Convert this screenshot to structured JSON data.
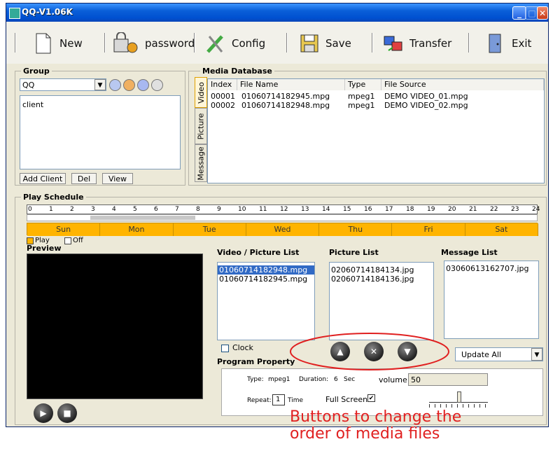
{
  "window": {
    "title": "QQ-V1.06K"
  },
  "toolbar": {
    "new": "New",
    "password": "password",
    "config": "Config",
    "save": "Save",
    "transfer": "Transfer",
    "exit": "Exit"
  },
  "group": {
    "legend": "Group",
    "selected": "QQ",
    "clients": [
      "client"
    ],
    "add_client": "Add Client",
    "del": "Del",
    "view": "View"
  },
  "media": {
    "legend": "Media Database",
    "tabs": [
      "Video",
      "Picture",
      "Message"
    ],
    "columns": [
      "Index",
      "File Name",
      "Type",
      "File Source"
    ],
    "rows": [
      [
        "00001",
        "01060714182945.mpg",
        "mpeg1",
        "DEMO VIDEO_01.mpg"
      ],
      [
        "00002",
        "01060714182948.mpg",
        "mpeg1",
        "DEMO VIDEO_02.mpg"
      ]
    ]
  },
  "schedule": {
    "legend": "Play Schedule",
    "hours": [
      "0",
      "1",
      "2",
      "3",
      "4",
      "5",
      "6",
      "7",
      "8",
      "9",
      "10",
      "11",
      "12",
      "13",
      "14",
      "15",
      "16",
      "17",
      "18",
      "19",
      "20",
      "21",
      "22",
      "23",
      "24"
    ],
    "days": [
      "Sun",
      "Mon",
      "Tue",
      "Wed",
      "Thu",
      "Fri",
      "Sat"
    ],
    "legend_play": "Play",
    "legend_off": "Off",
    "day_color": "#ffb400"
  },
  "preview": {
    "label": "Preview"
  },
  "lists": {
    "video_title": "Video / Picture List",
    "video_items": [
      "01060714182948.mpg",
      "01060714182945.mpg"
    ],
    "picture_title": "Picture List",
    "picture_items": [
      "02060714184134.jpg",
      "02060714184136.jpg"
    ],
    "message_title": "Message List",
    "message_items": [
      "03060613162707.jpg"
    ]
  },
  "controls": {
    "clock": "Clock",
    "update_select": "Update All",
    "program_property": "Program Property",
    "type_label": "Type:",
    "type_value": "mpeg1",
    "duration_label": "Duration:",
    "duration_value": "6",
    "duration_unit": "Sec",
    "volume_label": "volume",
    "volume_value": "50",
    "repeat_label": "Repeat:",
    "repeat_value": "1",
    "repeat_unit": "Time",
    "fullscreen_label": "Full Screen"
  },
  "annotation": {
    "line1": "Buttons to change the",
    "line2": "order of media files",
    "color": "#e02020"
  }
}
